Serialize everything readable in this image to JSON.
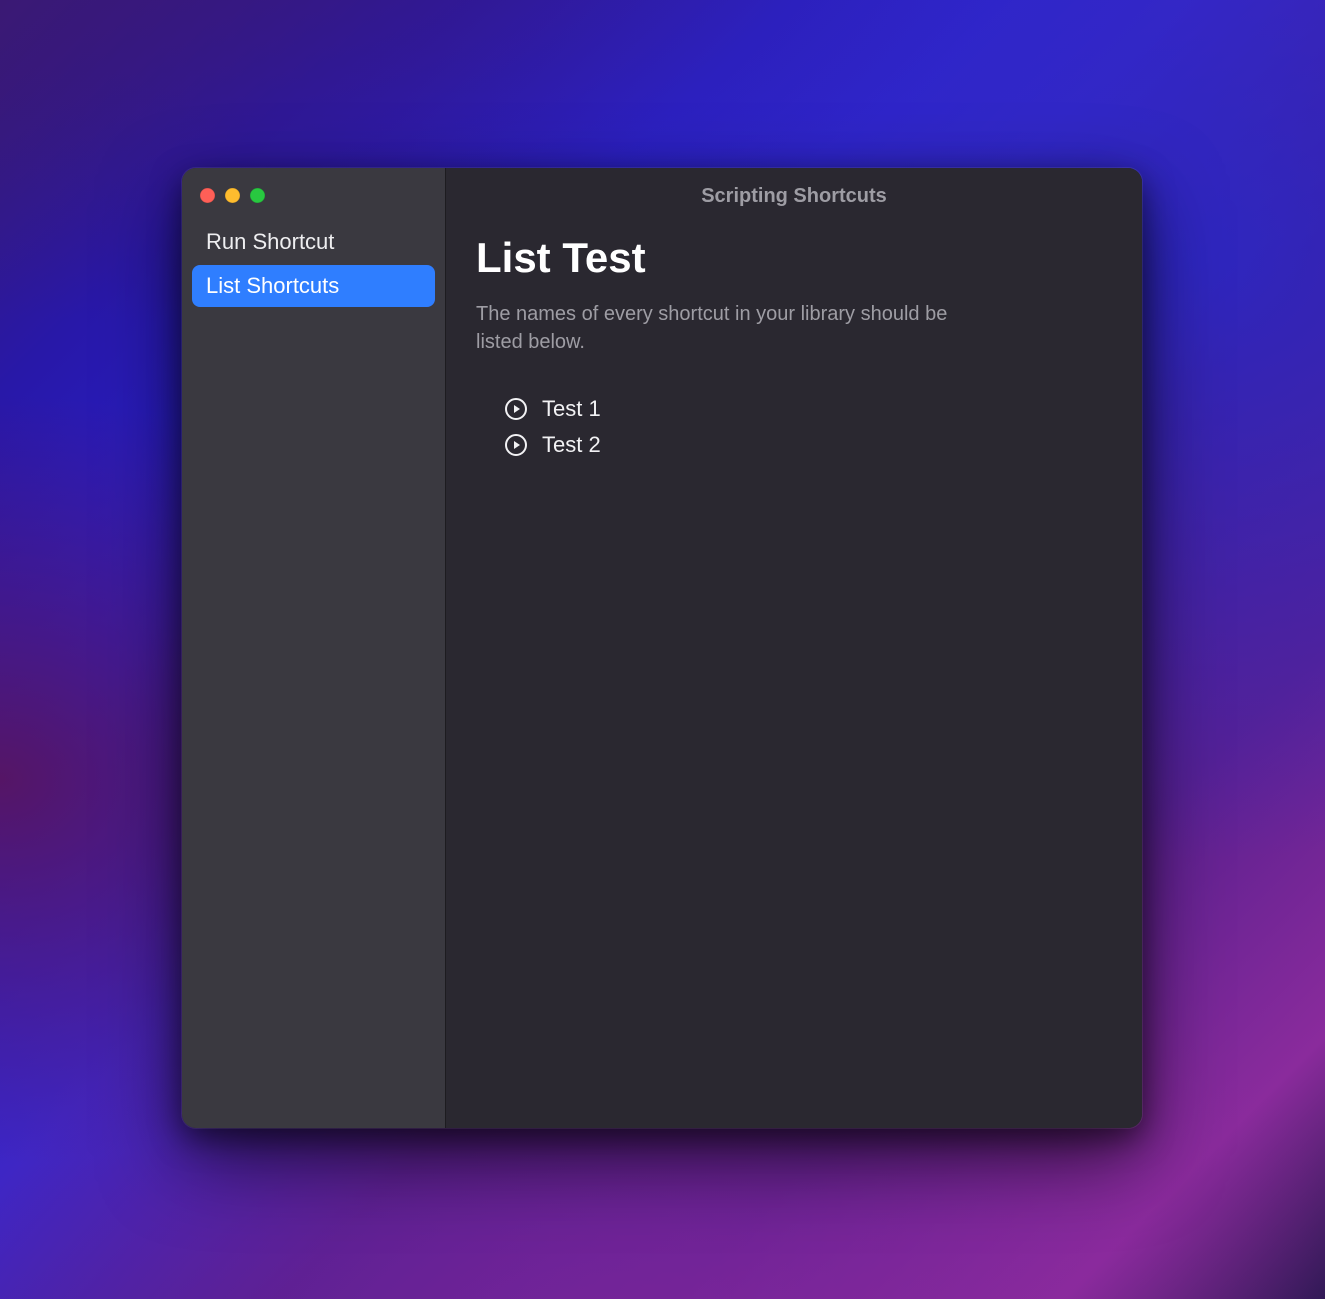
{
  "window": {
    "title": "Scripting Shortcuts"
  },
  "sidebar": {
    "items": [
      {
        "label": "Run Shortcut",
        "selected": false
      },
      {
        "label": "List Shortcuts",
        "selected": true
      }
    ]
  },
  "main": {
    "heading": "List Test",
    "description": "The names of every shortcut in your library should be listed below.",
    "shortcuts": [
      {
        "label": "Test 1"
      },
      {
        "label": "Test 2"
      }
    ]
  },
  "colors": {
    "accent": "#2f7eff",
    "close": "#ff5f57",
    "minimize": "#febc2e",
    "zoom": "#28c840"
  }
}
